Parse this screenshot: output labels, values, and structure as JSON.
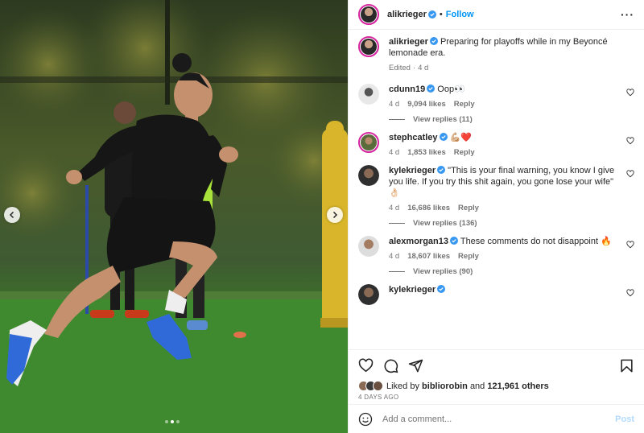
{
  "header": {
    "username": "alikrieger",
    "separator": "•",
    "follow_label": "Follow",
    "more_icon": "more-horizontal-icon"
  },
  "caption": {
    "username": "alikrieger",
    "text": "Preparing for playoffs while in my Beyoncé lemonade era.",
    "edited": "Edited",
    "separator": "·",
    "age": "4 d"
  },
  "comments": [
    {
      "username": "cdunn19",
      "verified": true,
      "text": "Oop👀",
      "age": "4 d",
      "likes": "9,094 likes",
      "reply_label": "Reply",
      "view_replies": "View replies (11)",
      "avatar_color": "#d9d9d9"
    },
    {
      "username": "stephcatley",
      "verified": true,
      "text": "💪🏼❤️",
      "age": "4 d",
      "likes": "1,853 likes",
      "reply_label": "Reply",
      "view_replies": "",
      "avatar_color": "#5a6b3c"
    },
    {
      "username": "kylekrieger",
      "verified": true,
      "text": "\"This is your final warning, you know I give you life. If you try this shit again, you gone lose your wife\" 👌🏻",
      "age": "4 d",
      "likes": "16,686 likes",
      "reply_label": "Reply",
      "view_replies": "View replies (136)",
      "avatar_color": "#3d3d3d"
    },
    {
      "username": "alexmorgan13",
      "verified": true,
      "text": "These comments do not disappoint 🔥",
      "age": "4 d",
      "likes": "18,607 likes",
      "reply_label": "Reply",
      "view_replies": "View replies (90)",
      "avatar_color": "#c9b8a8"
    },
    {
      "username": "kylekrieger",
      "verified": true,
      "text": "",
      "age": "",
      "likes": "",
      "reply_label": "",
      "view_replies": "",
      "avatar_color": "#3d3d3d"
    }
  ],
  "actions": {
    "like_icon": "heart-icon",
    "comment_icon": "comment-icon",
    "share_icon": "share-icon",
    "save_icon": "bookmark-icon",
    "liked_by_prefix": "Liked by",
    "liked_by_user": "bibliorobin",
    "liked_by_and": "and",
    "liked_by_others": "121,961 others",
    "date": "4 DAYS AGO"
  },
  "add_comment": {
    "placeholder": "Add a comment...",
    "post_label": "Post"
  },
  "colors": {
    "accent": "#0095f6",
    "verified": "#3897f0",
    "post_disabled": "#b3dbff"
  }
}
